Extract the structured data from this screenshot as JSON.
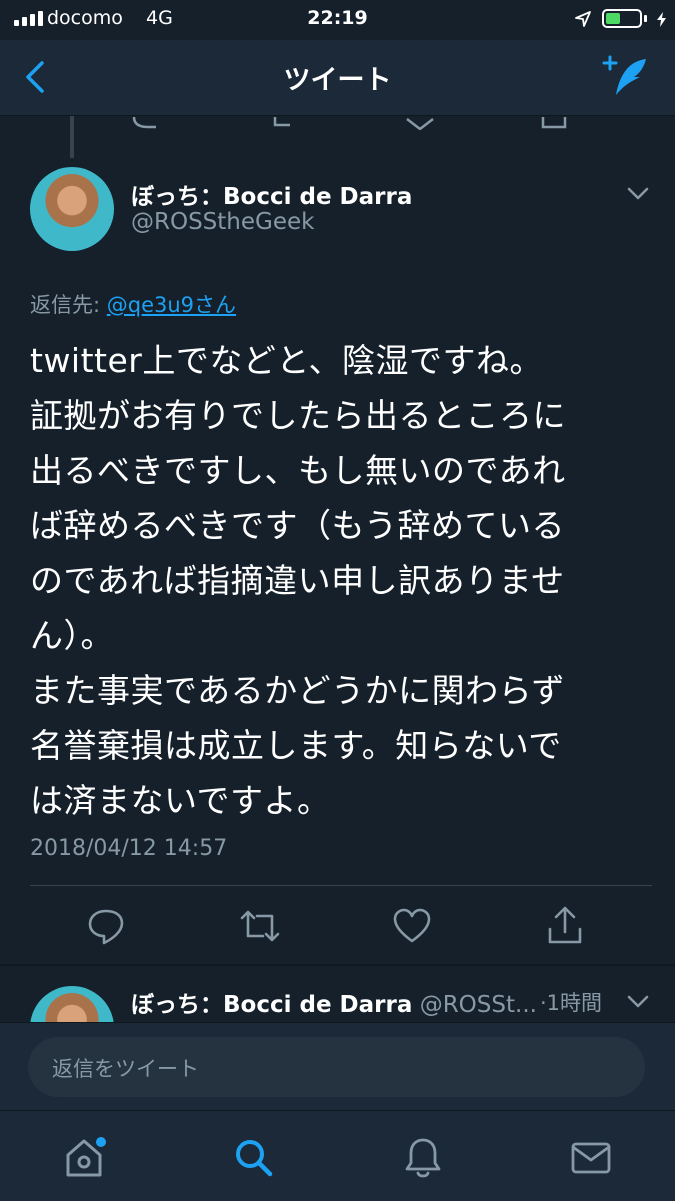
{
  "status_bar": {
    "carrier": "docomo",
    "network": "4G",
    "time": "22:19"
  },
  "nav": {
    "title": "ツイート",
    "back_icon": "chevron-left-icon",
    "compose_icon": "compose-tweet-icon"
  },
  "tweet": {
    "display_name": "ぼっち：Bocci de Darra",
    "handle": "@ROSStheGeek",
    "reply_prefix": "返信先: ",
    "reply_target": "@qe3u9さん",
    "text_lines": [
      "twitter上でなどと、陰湿ですね。",
      "証拠がお有りでしたら出るところに",
      "出るべきですし、もし無いのであれ",
      "ば辞めるべきです（もう辞めている",
      "のであれば指摘違い申し訳ありませ",
      "ん）。",
      "また事実であるかどうかに関わらず",
      "名誉棄損は成立します。知らないで",
      "は済まないですよ。"
    ],
    "timestamp": "2018/04/12 14:57"
  },
  "reply_preview": {
    "display_name": "ぼっち：Bocci de Darra",
    "handle": "@ROSSt...",
    "time": "·1時間"
  },
  "reply_input": {
    "placeholder": "返信をツイート"
  },
  "colors": {
    "background": "#15202b",
    "bar": "#1c2938",
    "accent": "#1da1f2",
    "muted": "#8899a6",
    "battery": "#4cd964"
  }
}
